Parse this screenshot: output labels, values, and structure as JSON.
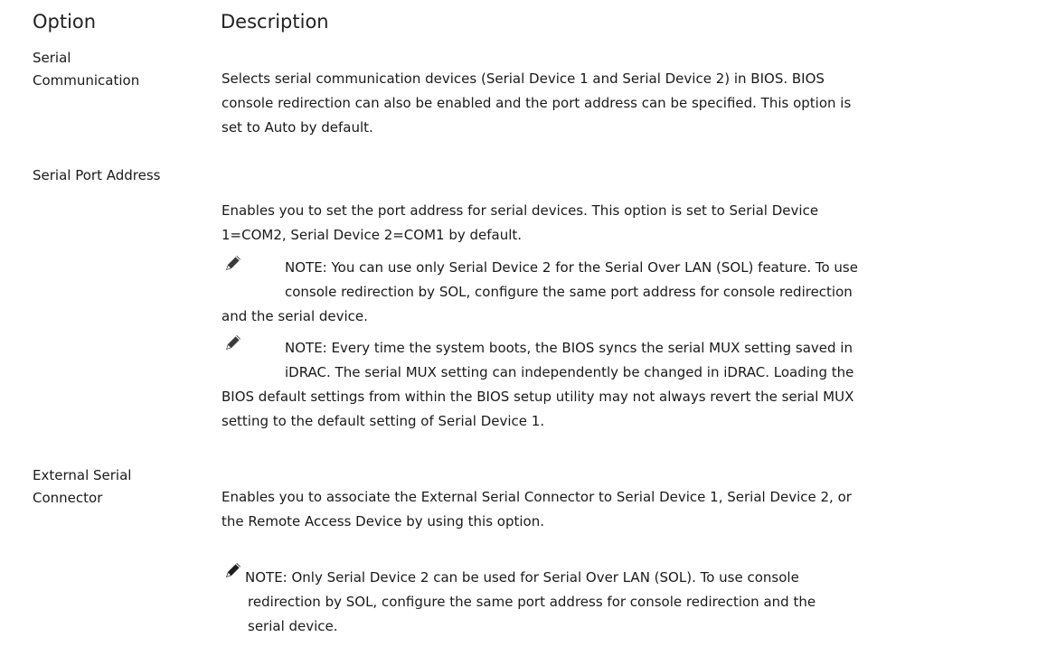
{
  "header": {
    "option_label": "Option",
    "description_label": "Description"
  },
  "rows": [
    {
      "option_lines": [
        "Serial",
        "Communication"
      ],
      "description_lines": [
        "Selects serial communication devices (Serial Device 1 and Serial Device 2) in BIOS. BIOS",
        "console redirection can also be enabled and the port address can be specified. This option is",
        "set to Auto by default."
      ]
    },
    {
      "option_lines": [
        "Serial Port Address"
      ],
      "description_lines": [
        "Enables you to set the port address for serial devices. This option is set to Serial Device",
        "1=COM2, Serial Device 2=COM1 by default."
      ],
      "notes": [
        {
          "icon": "pencil-icon",
          "lines": [
            "NOTE: You can use only Serial Device 2 for the Serial Over LAN (SOL) feature. To use",
            "console redirection by SOL, configure the same port address for console redirection",
            "and the serial device."
          ]
        },
        {
          "icon": "pencil-icon",
          "lines": [
            "NOTE: Every time the system boots, the BIOS syncs the serial MUX setting saved in",
            "iDRAC. The serial MUX setting can independently be changed in iDRAC. Loading the",
            "BIOS default settings from within the BIOS setup utility may not always revert the serial MUX",
            "setting to the default setting of Serial Device 1."
          ]
        }
      ]
    },
    {
      "option_lines": [
        "External Serial",
        "Connector"
      ],
      "description_lines": [
        "Enables you to associate the External Serial Connector to Serial Device 1, Serial Device 2, or",
        "the Remote Access Device by using this option."
      ],
      "notes": [
        {
          "icon": "pencil-icon",
          "lines": [
            "NOTE: Only Serial Device 2 can be used for Serial Over LAN (SOL). To use console",
            "redirection by SOL, configure the same port address for console redirection and the",
            "serial device."
          ]
        }
      ]
    }
  ]
}
